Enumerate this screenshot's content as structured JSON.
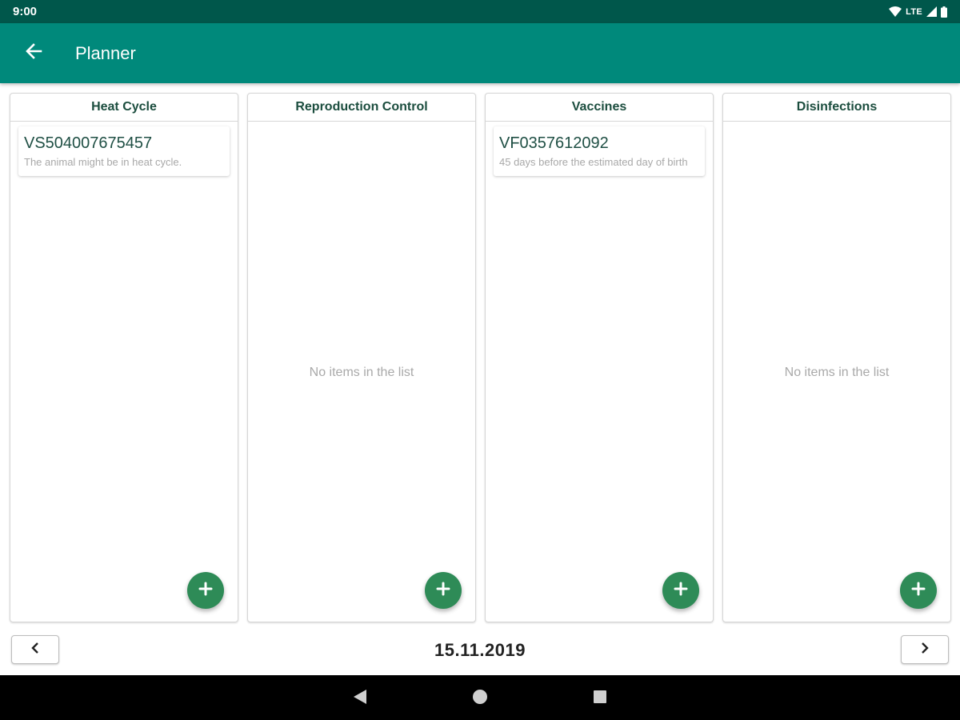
{
  "status_bar": {
    "time": "9:00",
    "network": "LTE",
    "icons": [
      "wifi-icon",
      "signal-icon",
      "battery-icon"
    ]
  },
  "app_bar": {
    "title": "Planner",
    "back_icon": "arrow-back-icon",
    "color": "#00897b"
  },
  "columns": [
    {
      "title": "Heat Cycle",
      "items": [
        {
          "id": "VS504007675457",
          "description": "The animal might be in heat cycle."
        }
      ],
      "empty_text": ""
    },
    {
      "title": "Reproduction Control",
      "items": [],
      "empty_text": "No items in the list"
    },
    {
      "title": "Vaccines",
      "items": [
        {
          "id": "VF0357612092",
          "description": "45 days before the estimated day of birth"
        }
      ],
      "empty_text": ""
    },
    {
      "title": "Disinfections",
      "items": [],
      "empty_text": "No items in the list"
    }
  ],
  "add_icon": "plus-icon",
  "fab_color": "#2e8b57",
  "date_nav": {
    "date": "15.11.2019",
    "prev_icon": "chevron-left-icon",
    "next_icon": "chevron-right-icon"
  },
  "system_nav": {
    "icons": [
      "back-triangle-icon",
      "home-circle-icon",
      "recents-square-icon"
    ]
  }
}
